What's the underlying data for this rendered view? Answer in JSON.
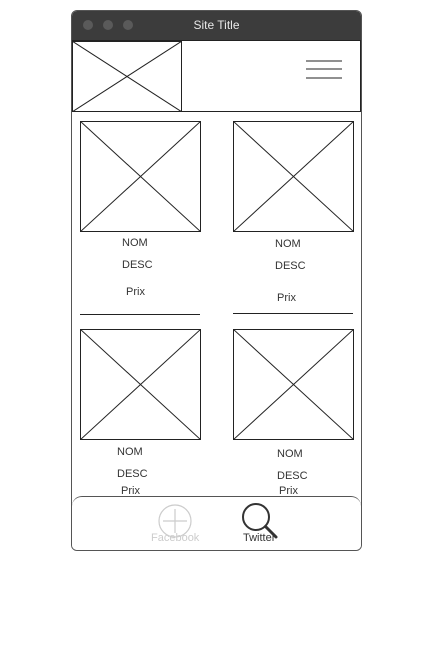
{
  "window": {
    "title": "Site Title"
  },
  "products": [
    {
      "name": "NOM",
      "desc": "DESC",
      "price": "Prix"
    },
    {
      "name": "NOM",
      "desc": "DESC",
      "price": "Prix"
    },
    {
      "name": "NOM",
      "desc": "DESC",
      "price": "Prix"
    },
    {
      "name": "NOM",
      "desc": "DESC",
      "price": "Prix"
    }
  ],
  "tabbar": {
    "items": [
      {
        "label": "Facebook",
        "icon": "plus-circle-icon",
        "active": false
      },
      {
        "label": "Twitter",
        "icon": "search-icon",
        "active": true
      }
    ]
  },
  "colors": {
    "titlebar": "#3c3c3c",
    "inactive_tab": "#cccccc",
    "active_tab": "#333333"
  }
}
